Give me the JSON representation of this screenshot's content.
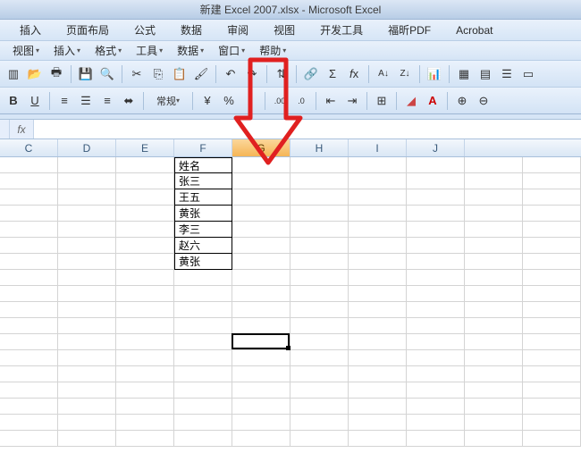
{
  "title": "新建 Excel 2007.xlsx - Microsoft Excel",
  "menu1": {
    "insert": "插入",
    "layout": "页面布局",
    "formula": "公式",
    "data": "数据",
    "review": "审阅",
    "view": "视图",
    "dev": "开发工具",
    "foxit": "福昕PDF",
    "acrobat": "Acrobat"
  },
  "menu2": {
    "view": "视图",
    "insert": "插入",
    "format": "格式",
    "tools": "工具",
    "data": "数据",
    "window": "窗口",
    "help": "帮助"
  },
  "format_dropdown": "常规",
  "fx_label": "fx",
  "columns": [
    "C",
    "D",
    "E",
    "F",
    "G",
    "H",
    "I",
    "J"
  ],
  "selected_col": "G",
  "data_cells": {
    "col": "F",
    "values": [
      "姓名",
      "张三",
      "王五",
      "黄张",
      "李三",
      "赵六",
      "黄张"
    ]
  },
  "active_cell": {
    "col": "G",
    "row": 12
  }
}
